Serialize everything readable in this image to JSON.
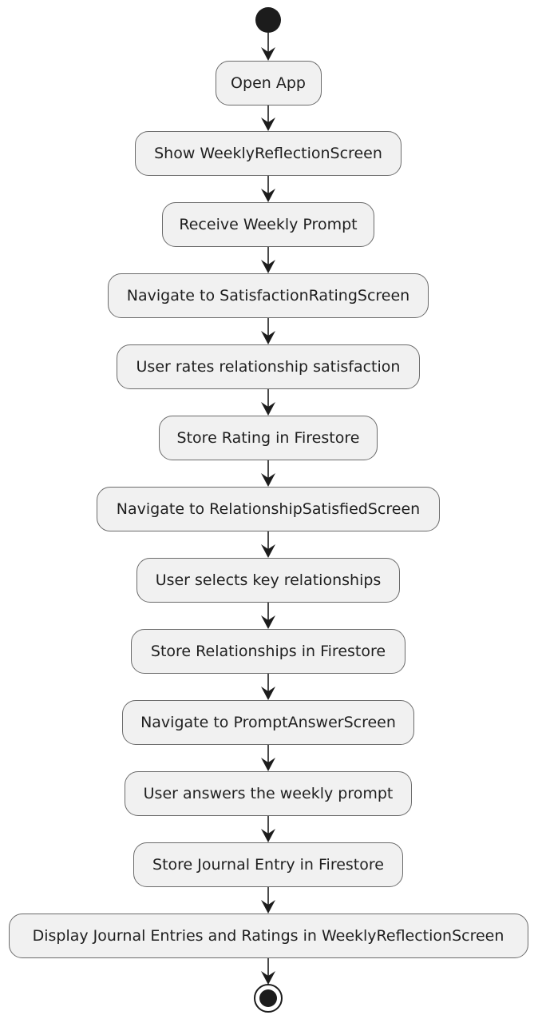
{
  "diagram": {
    "type": "activity",
    "colors": {
      "node_fill": "#f1f1f1",
      "node_border": "#6b6b6b",
      "text": "#1f1f1f",
      "arrow": "#1c1c1c",
      "start_end": "#1c1c1c"
    },
    "start": "start-node",
    "end": "end-node",
    "steps": [
      "Open App",
      "Show WeeklyReflectionScreen",
      "Receive Weekly Prompt",
      "Navigate to SatisfactionRatingScreen",
      "User rates relationship satisfaction",
      "Store Rating in Firestore",
      "Navigate to RelationshipSatisfiedScreen",
      "User selects key relationships",
      "Store Relationships in Firestore",
      "Navigate to PromptAnswerScreen",
      "User answers the weekly prompt",
      "Store Journal Entry in Firestore",
      "Display Journal Entries and Ratings in WeeklyReflectionScreen"
    ]
  }
}
